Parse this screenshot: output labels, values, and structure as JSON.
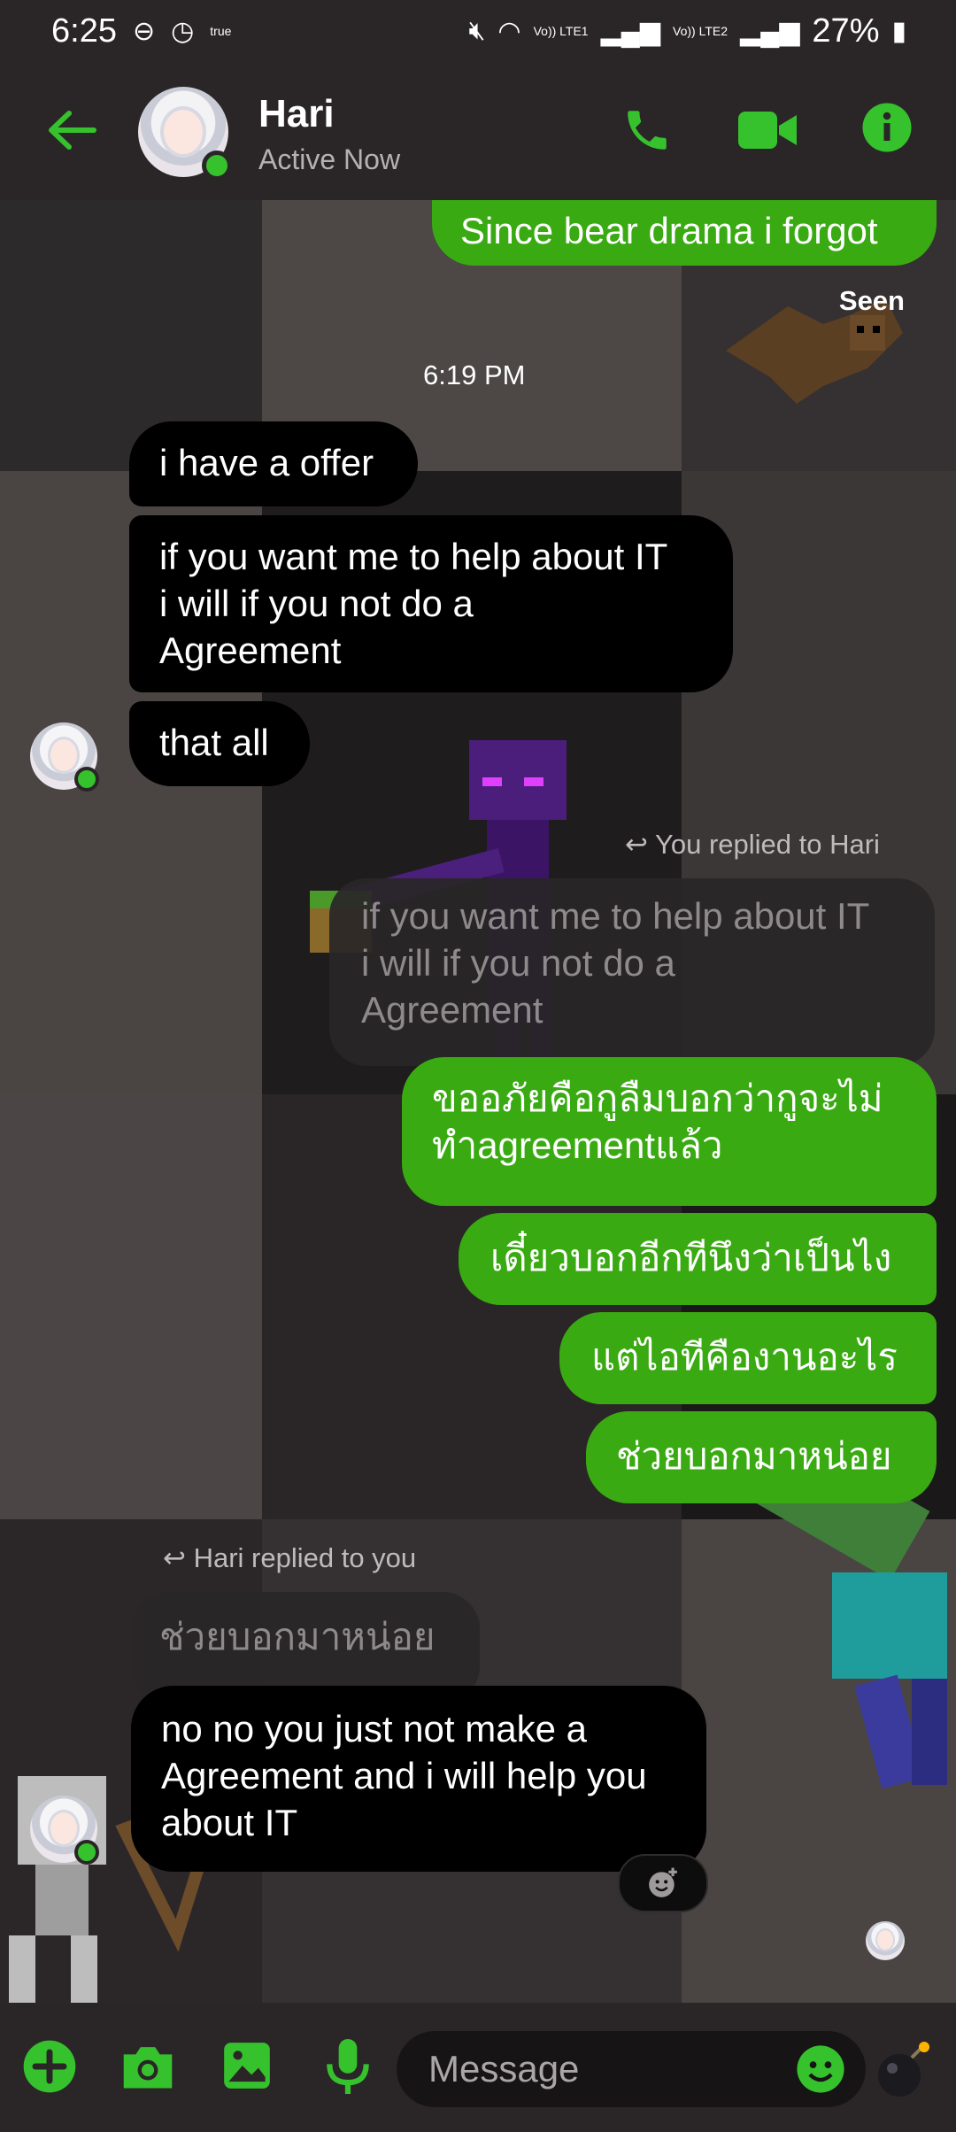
{
  "status_bar": {
    "time": "6:25",
    "carrier_icon_text": "true",
    "lte1": "Vo)) LTE1",
    "lte2": "Vo)) LTE2",
    "battery": "27%"
  },
  "header": {
    "contact_name": "Hari",
    "presence": "Active Now"
  },
  "messages": [
    {
      "dir": "out",
      "text": "Since bear drama i forgot"
    },
    {
      "dir": "meta",
      "text": "Seen"
    },
    {
      "dir": "time",
      "text": "6:19 PM"
    },
    {
      "dir": "in",
      "text": "i have a offer"
    },
    {
      "dir": "in",
      "text": "if you want me to help about IT\ni will if you  not do a\nAgreement"
    },
    {
      "dir": "in",
      "text": "that all"
    },
    {
      "dir": "reply_meta",
      "text": "You replied to Hari"
    },
    {
      "dir": "quote",
      "text": "if you want me to help about IT\ni will if you  not do a\nAgreement"
    },
    {
      "dir": "out",
      "text": "ขออภัยคือกูลืมบอกว่ากูจะไม่\nทำagreementแล้ว"
    },
    {
      "dir": "out",
      "text": "เดี๋ยวบอกอีกทีนึงว่าเป็นไง"
    },
    {
      "dir": "out",
      "text": "แต่ไอทีคืองานอะไร"
    },
    {
      "dir": "out",
      "text": "ช่วยบอกมาหน่อย"
    },
    {
      "dir": "reply_meta",
      "text": "Hari replied to you"
    },
    {
      "dir": "quote",
      "text": "ช่วยบอกมาหน่อย"
    },
    {
      "dir": "in",
      "text": "no no you just not make a\nAgreement and i will help you\nabout IT"
    }
  ],
  "composer": {
    "placeholder": "Message"
  },
  "colors": {
    "accent": "#3aaa13",
    "icon_green": "#35c22d",
    "bg": "#2a2627",
    "incoming_bubble": "#000000"
  },
  "icons": [
    "back-arrow-icon",
    "phone-icon",
    "video-icon",
    "info-icon",
    "reply-icon",
    "add-reaction-icon",
    "plus-icon",
    "camera-icon",
    "image-icon",
    "mic-icon",
    "emoji-icon",
    "bomb-icon"
  ]
}
